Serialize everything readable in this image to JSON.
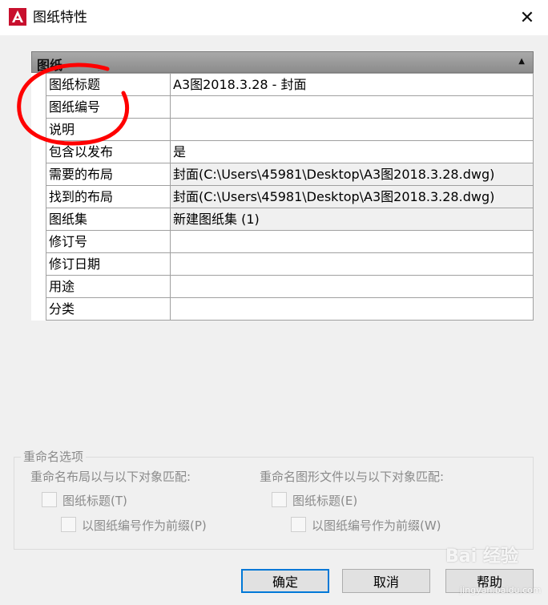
{
  "window": {
    "title": "图纸特性",
    "close_glyph": "✕"
  },
  "section": {
    "title": "图纸",
    "toggle_glyph": "▲"
  },
  "properties": [
    {
      "name": "图纸标题",
      "value": "A3图2018.3.28 - 封面",
      "readonly": false
    },
    {
      "name": "图纸编号",
      "value": "",
      "readonly": false
    },
    {
      "name": "说明",
      "value": "",
      "readonly": false
    },
    {
      "name": "包含以发布",
      "value": "是",
      "readonly": false
    },
    {
      "name": "需要的布局",
      "value": "封面(C:\\Users\\45981\\Desktop\\A3图2018.3.28.dwg)",
      "readonly": true
    },
    {
      "name": "找到的布局",
      "value": "封面(C:\\Users\\45981\\Desktop\\A3图2018.3.28.dwg)",
      "readonly": true
    },
    {
      "name": "图纸集",
      "value": "新建图纸集 (1)",
      "readonly": true
    },
    {
      "name": "修订号",
      "value": "",
      "readonly": false
    },
    {
      "name": "修订日期",
      "value": "",
      "readonly": false
    },
    {
      "name": "用途",
      "value": "",
      "readonly": false
    },
    {
      "name": "分类",
      "value": "",
      "readonly": false
    }
  ],
  "rename_options": {
    "legend": "重命名选项",
    "layout_label": "重命名布局以与以下对象匹配:",
    "layout_title_checkbox": "图纸标题(T)",
    "layout_prefix_checkbox": "以图纸编号作为前缀(P)",
    "file_label": "重命名图形文件以与以下对象匹配:",
    "file_title_checkbox": "图纸标题(E)",
    "file_prefix_checkbox": "以图纸编号作为前缀(W)"
  },
  "buttons": {
    "ok": "确定",
    "cancel": "取消",
    "help": "帮助"
  },
  "watermark": {
    "text": "Bai 经验",
    "url": "jingyan.baidu.com"
  },
  "colors": {
    "accent": "#0078d7",
    "annotation": "#ff0000",
    "autocad_red": "#c8102e"
  }
}
